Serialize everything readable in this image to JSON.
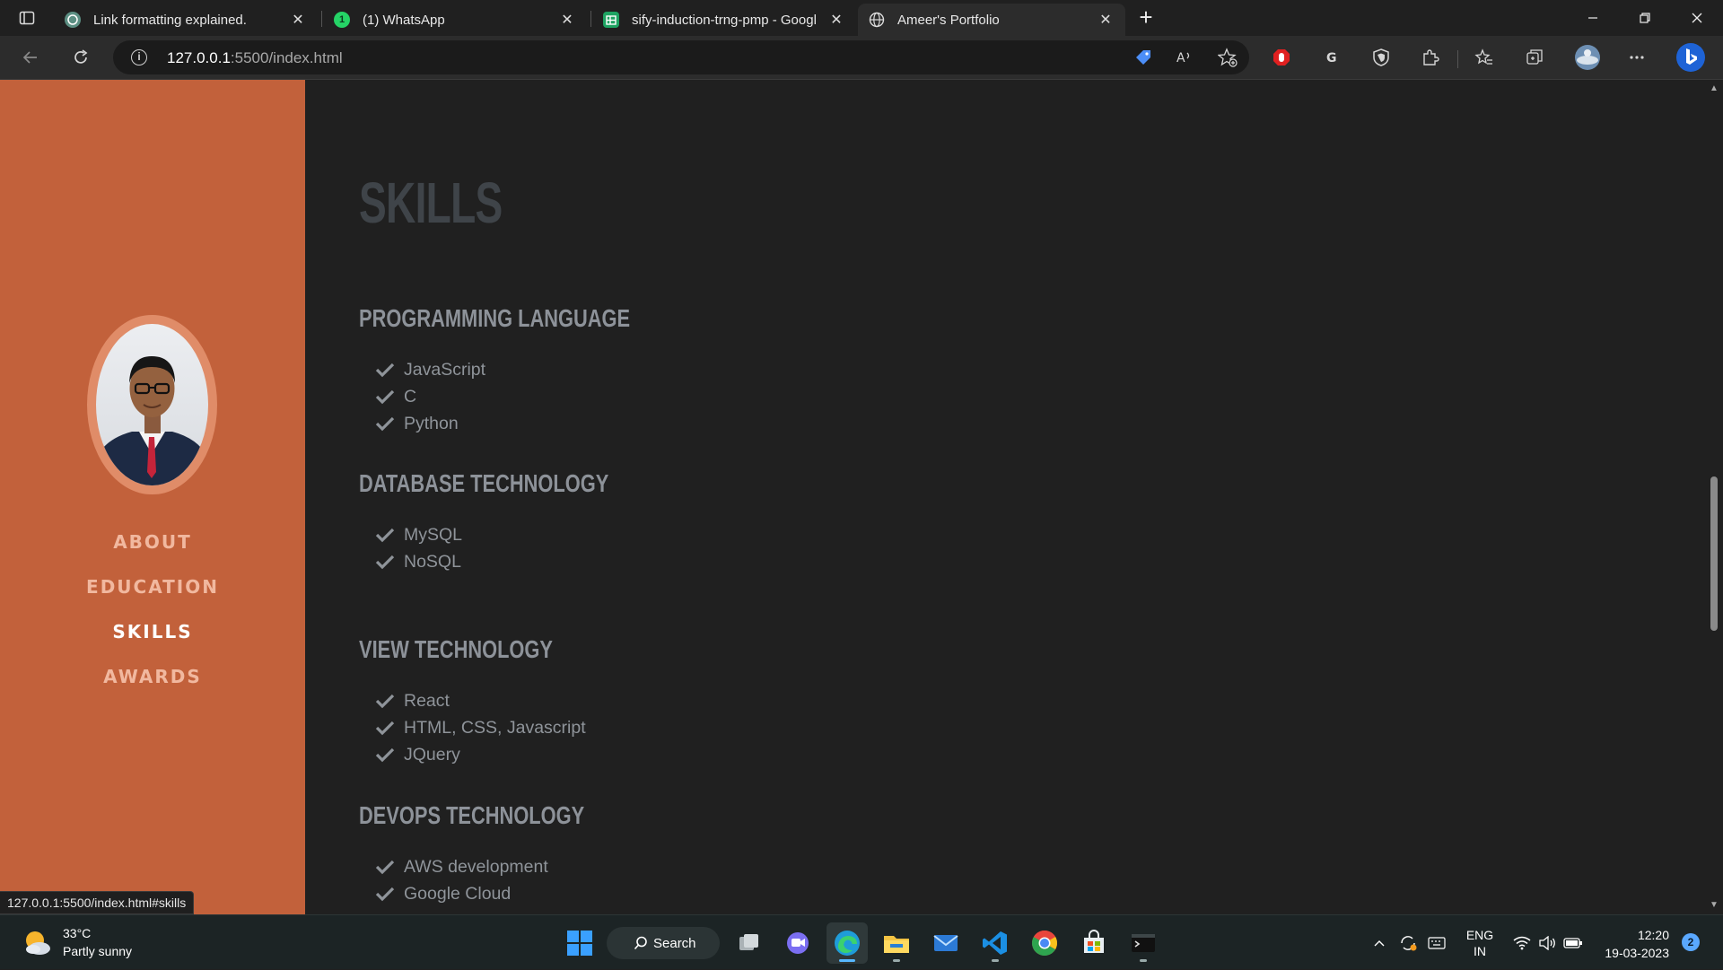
{
  "browser": {
    "tabs": [
      {
        "title": "Link formatting explained.",
        "icon": "chatgpt-icon"
      },
      {
        "title": "(1) WhatsApp",
        "icon": "whatsapp-icon"
      },
      {
        "title": "sify-induction-trng-pmp - Googl",
        "icon": "google-sheets-icon"
      },
      {
        "title": "Ameer's Portfolio",
        "icon": "globe-icon"
      }
    ],
    "url_host": "127.0.0.1",
    "url_rest": ":5500/index.html",
    "status_url": "127.0.0.1:5500/index.html#skills"
  },
  "sidebar": {
    "nav": [
      {
        "label": "ABOUT",
        "current": false
      },
      {
        "label": "EDUCATION",
        "current": false
      },
      {
        "label": "SKILLS",
        "current": true
      },
      {
        "label": "AWARDS",
        "current": false
      }
    ]
  },
  "skills": {
    "title": "SKILLS",
    "groups": [
      {
        "heading": "PROGRAMMING LANGUAGE",
        "items": [
          "JavaScript",
          "C",
          "Python"
        ]
      },
      {
        "heading": "DATABASE TECHNOLOGY",
        "items": [
          "MySQL",
          "NoSQL"
        ]
      },
      {
        "heading": "VIEW TECHNOLOGY",
        "items": [
          "React",
          "HTML, CSS, Javascript",
          "JQuery"
        ]
      },
      {
        "heading": "DEVOPS TECHNOLOGY",
        "items": [
          "AWS development",
          "Google Cloud"
        ]
      }
    ]
  },
  "taskbar": {
    "weather_temp": "33°C",
    "weather_desc": "Partly sunny",
    "search_label": "Search",
    "lang_top": "ENG",
    "lang_bottom": "IN",
    "time": "12:20",
    "date": "19-03-2023",
    "notifications": "2"
  },
  "colors": {
    "sidebar": "#c2613b",
    "background": "#202020",
    "nav_active": "#ffffff",
    "nav_inactive": "#f1b89f"
  }
}
